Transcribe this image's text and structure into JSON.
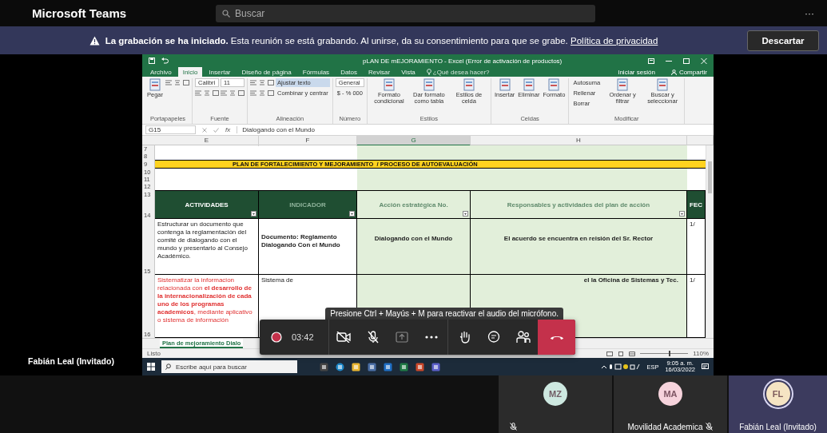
{
  "app_title": "Microsoft Teams",
  "search": {
    "placeholder": "Buscar"
  },
  "more": "···",
  "banner": {
    "message": "**La grabación se ha iniciado.** Esta reunión se está grabando. Al unirse, da su consentimiento para que se grabe.",
    "link": "Política de privacidad",
    "button": "Descartar"
  },
  "presenter": "Fabián Leal (Invitado)",
  "excel": {
    "title": "pLAN DE mEJORAMIENTO - Excel (Error de activación de productos)",
    "tabs": [
      {
        "label": "Archivo",
        "selected": false
      },
      {
        "label": "Inicio",
        "selected": true
      },
      {
        "label": "Insertar",
        "selected": false
      },
      {
        "label": "Diseño de página",
        "selected": false
      },
      {
        "label": "Fórmulas",
        "selected": false
      },
      {
        "label": "Datos",
        "selected": false
      },
      {
        "label": "Revisar",
        "selected": false
      },
      {
        "label": "Vista",
        "selected": false
      }
    ],
    "tell_me": "¿Qué desea hacer?",
    "sign_in": "Iniciar sesión",
    "share": "Compartir",
    "ribbon": [
      {
        "label": "Portapapeles",
        "columns": [
          [
            {
              "kind": "big",
              "label": "Pegar"
            }
          ],
          [
            {
              "kind": "icons"
            }
          ]
        ]
      },
      {
        "label": "Fuente",
        "columns": [
          [
            {
              "kind": "field",
              "label": "Calibri"
            },
            {
              "kind": "icons"
            }
          ],
          [
            {
              "kind": "field",
              "label": "11"
            },
            {
              "kind": "icons"
            }
          ]
        ]
      },
      {
        "label": "Alineación",
        "columns": [
          [
            {
              "kind": "icons"
            },
            {
              "kind": "icons"
            }
          ],
          [
            {
              "kind": "small",
              "label": "Ajustar texto",
              "selected": true
            },
            {
              "kind": "small",
              "label": "Combinar y centrar",
              "selected": false
            }
          ]
        ]
      },
      {
        "label": "Número",
        "columns": [
          [
            {
              "kind": "field",
              "label": "General"
            },
            {
              "kind": "small",
              "label": "$ - % 000",
              "selected": false
            }
          ]
        ]
      },
      {
        "label": "Estilos",
        "columns": [
          [
            {
              "kind": "big",
              "label": "Formato condicional"
            }
          ],
          [
            {
              "kind": "big",
              "label": "Dar formato como tabla"
            }
          ],
          [
            {
              "kind": "big",
              "label": "Estilos de celda"
            }
          ]
        ]
      },
      {
        "label": "Celdas",
        "columns": [
          [
            {
              "kind": "big",
              "label": "Insertar"
            }
          ],
          [
            {
              "kind": "big",
              "label": "Eliminar"
            }
          ],
          [
            {
              "kind": "big",
              "label": "Formato"
            }
          ]
        ]
      },
      {
        "label": "Modificar",
        "columns": [
          [
            {
              "kind": "small",
              "label": "Autosuma",
              "selected": false
            },
            {
              "kind": "small",
              "label": "Rellenar",
              "selected": false
            },
            {
              "kind": "small",
              "label": "Borrar",
              "selected": false
            }
          ],
          [
            {
              "kind": "big",
              "label": "Ordenar y filtrar"
            }
          ],
          [
            {
              "kind": "big",
              "label": "Buscar y seleccionar"
            }
          ]
        ]
      }
    ],
    "name_box": "G15",
    "function_label": "fx",
    "formula": "Dialogando con el Mundo",
    "sheet": {
      "columns": [
        {
          "label": "E",
          "selected": false
        },
        {
          "label": "F",
          "selected": false
        },
        {
          "label": "G",
          "selected": true
        },
        {
          "label": "H",
          "selected": false
        }
      ],
      "rows": [
        {
          "kind": "blank",
          "number": "7"
        },
        {
          "kind": "blank",
          "number": "8"
        },
        {
          "kind": "title",
          "number": "9",
          "text": "PLAN DE FORTALECIMIENTO Y MEJORAMIENTO  / PROCESO DE AUTOEVALUACIÓN"
        },
        {
          "kind": "blank",
          "number": "10"
        },
        {
          "kind": "blank",
          "number": "11"
        },
        {
          "kind": "blank",
          "number": "12"
        },
        {
          "kind": "header",
          "numbers": [
            "13",
            "14"
          ],
          "cells": [
            {
              "kind": "dark",
              "text": "ACTIVIDADES"
            },
            {
              "kind": "muted",
              "text": "INDICADOR"
            },
            {
              "kind": "light",
              "text": "Acción estratégica No."
            },
            {
              "kind": "light",
              "text": "Responsables y actividades del plan de acción"
            },
            {
              "kind": "dark",
              "text": "FEC"
            }
          ]
        },
        {
          "kind": "data",
          "number": "15",
          "cells": [
            {
              "kind": "plain",
              "text": "Estructurar un documento que contenga la reglamentación del comité de dialogando con el mundo y presentarlo al Consejo Académico."
            },
            {
              "kind": "bold",
              "text": "Documento:  Reglamento Dialogando Con el Mundo"
            },
            {
              "kind": "center",
              "text": "Dialogando con el Mundo"
            },
            {
              "kind": "center",
              "text": "El acuerdo se encuentra en reisión del Sr. Rector"
            },
            {
              "kind": "plain",
              "text": "1/"
            }
          ]
        },
        {
          "kind": "data",
          "number": "16",
          "cells": [
            {
              "kind": "red",
              "text": "Sistematizar la informacion relacionada con **el desarrollo de la internacionalización de cada uno de los programas academicos**, mediante aplicativo o sistema de información"
            },
            {
              "kind": "plain",
              "text": "Sistema de"
            },
            {
              "kind": "center",
              "text": ""
            },
            {
              "kind": "right",
              "text": "el la Oficina de Sistemas y Tec."
            },
            {
              "kind": "plain",
              "text": "1/"
            }
          ]
        }
      ]
    },
    "sheet_tab": "Plan de mejoramiento Dialo",
    "status": "Listo",
    "zoom": {
      "label": "110%",
      "level": 0.6
    },
    "taskbar": {
      "search_placeholder": "Escribe aquí para buscar",
      "apps": [
        {
          "kind": "task-view"
        },
        {
          "kind": "edge"
        },
        {
          "kind": "folder"
        },
        {
          "kind": "store"
        },
        {
          "kind": "mail"
        },
        {
          "kind": "excel"
        },
        {
          "kind": "powerpoint"
        },
        {
          "kind": "teams"
        }
      ],
      "language": "ESP",
      "time": "9:05 a. m.",
      "date": "16/03/2022"
    }
  },
  "call": {
    "toast": "Presione Ctrl + Mayús + M para reactivar el audio del micrófono.",
    "recording": true,
    "timer": "03:42",
    "camera_on": false,
    "mic_on": false
  },
  "participants": [
    {
      "initials": "MZ",
      "color": "#cde8e0",
      "muted": true,
      "selected": false
    },
    {
      "initials": "MA",
      "name": "Movilidad Academica",
      "color": "#f6d3dc",
      "muted": true,
      "selected": false
    },
    {
      "initials": "FL",
      "name": "Fabián Leal (Invitado)",
      "color": "#f5e4c3",
      "muted": false,
      "selected": true
    }
  ]
}
